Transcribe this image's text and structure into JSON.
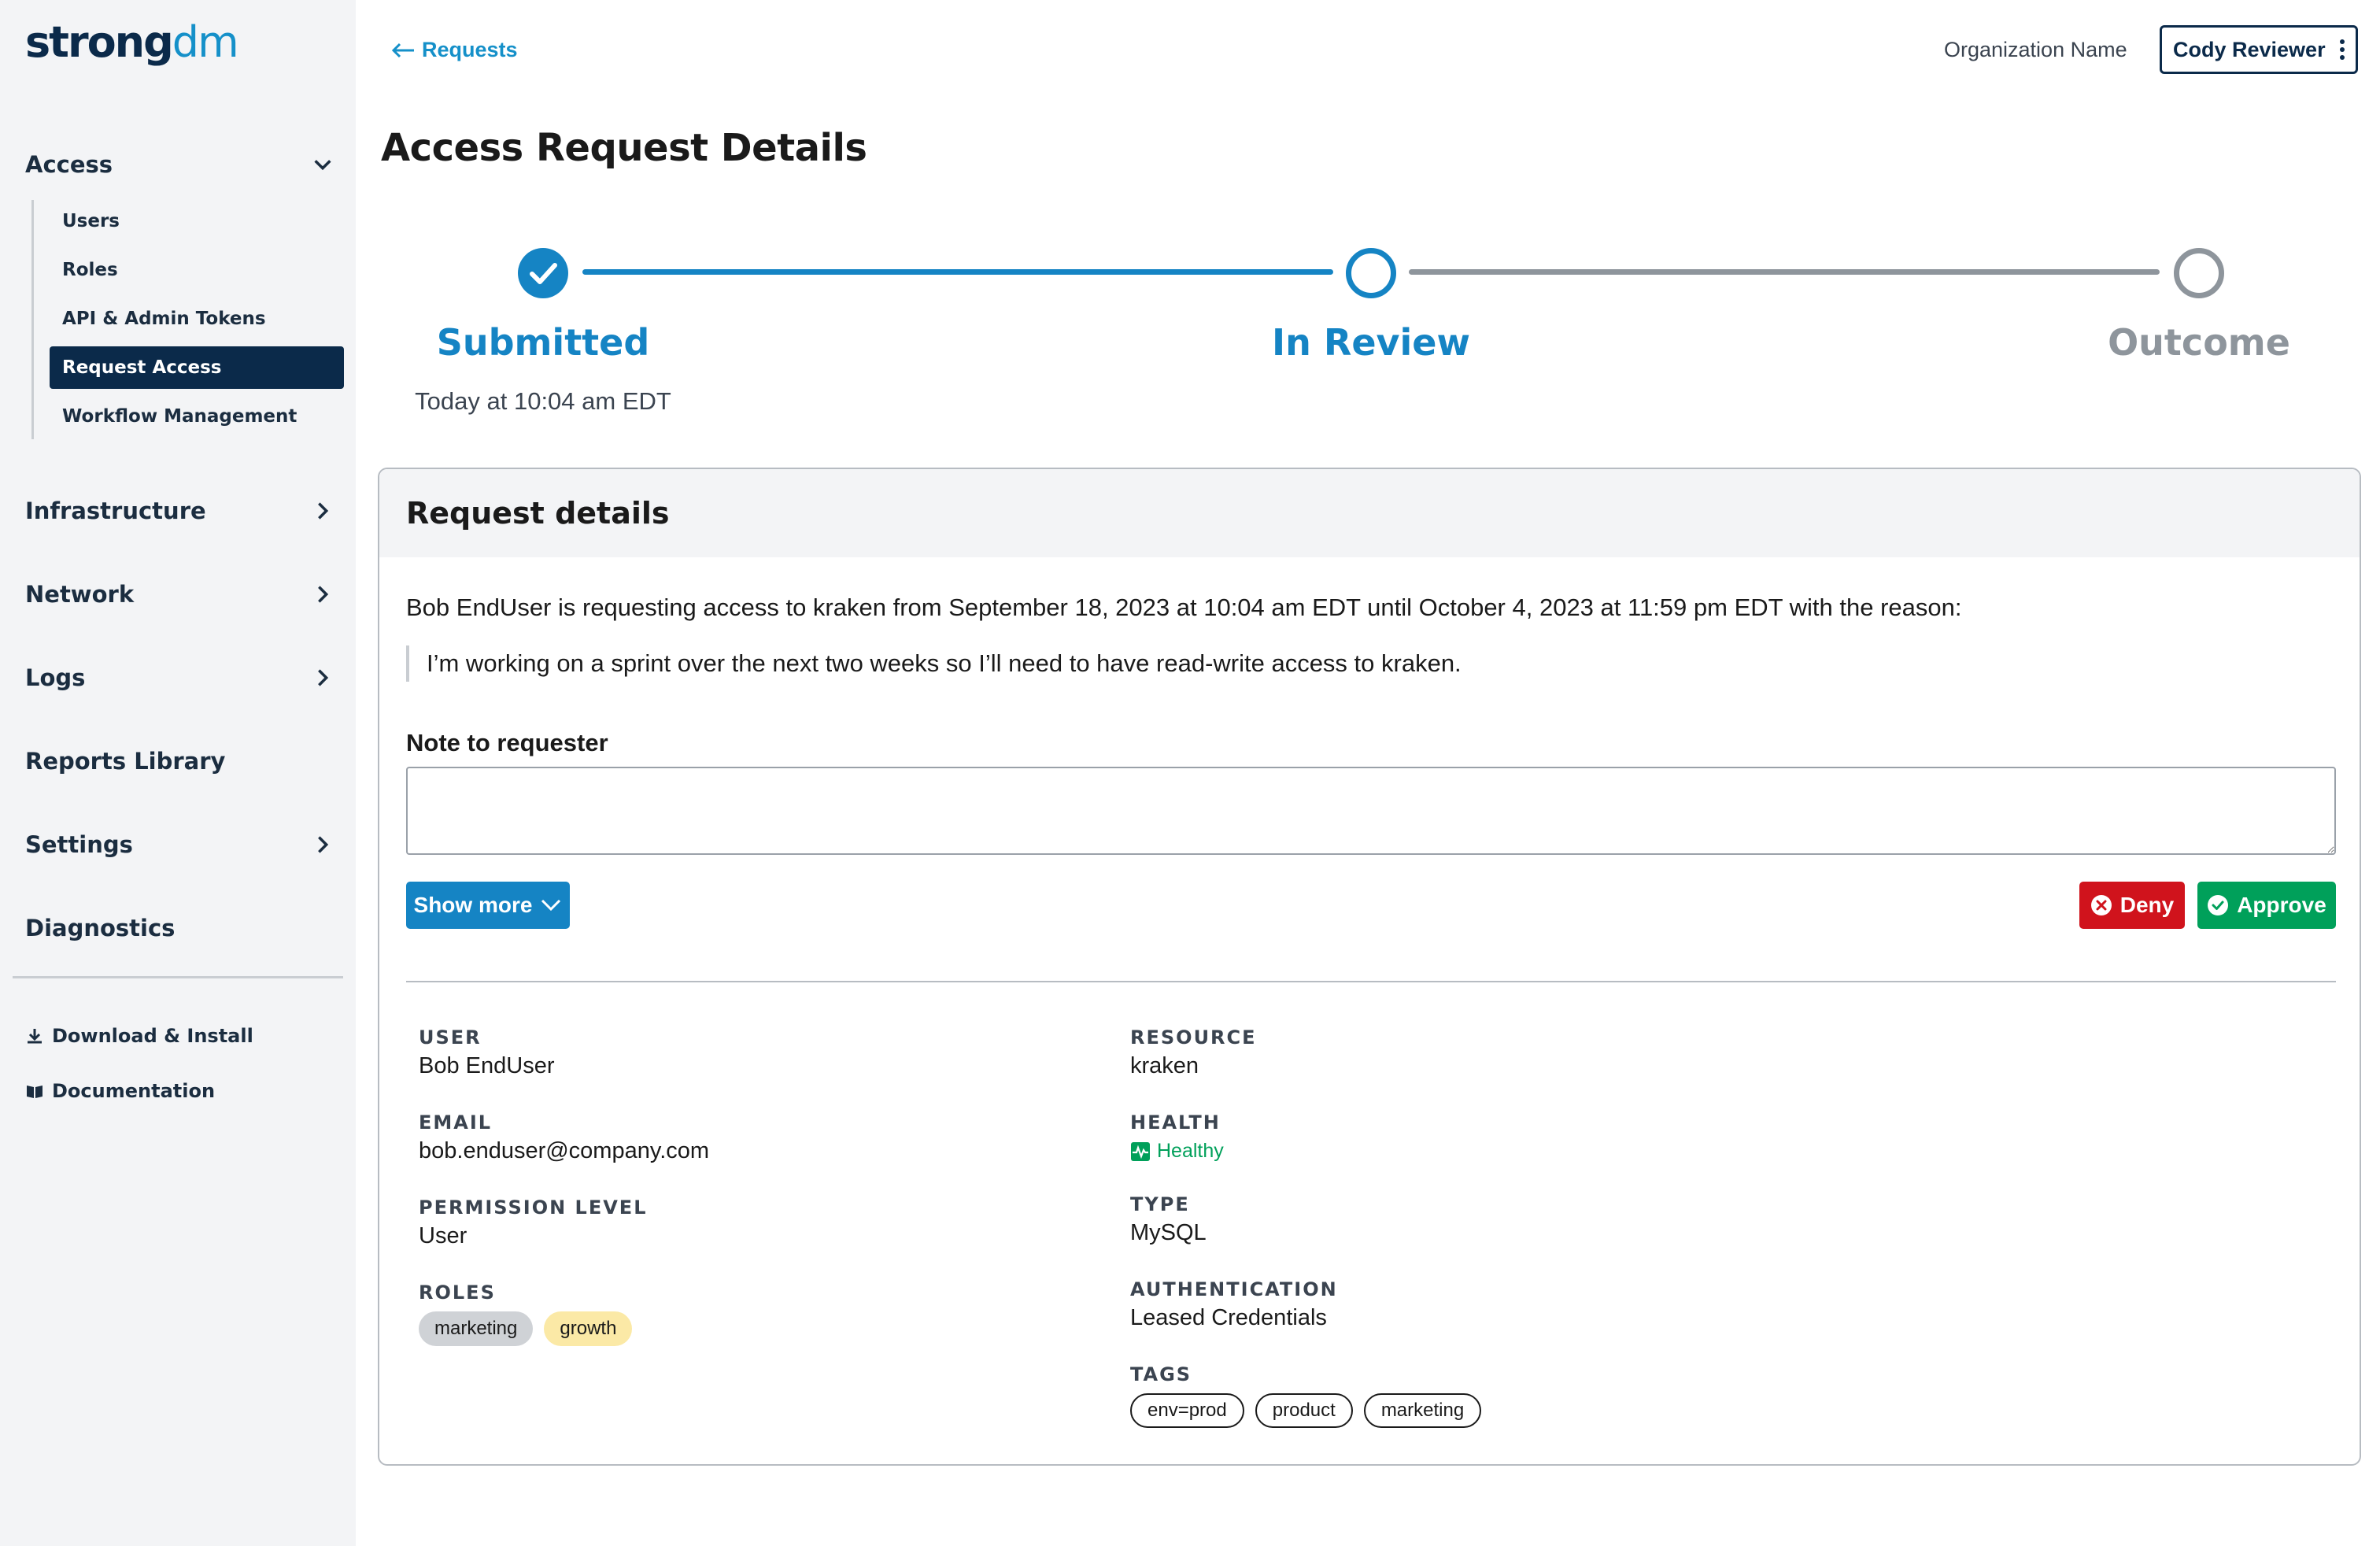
{
  "brand": {
    "strong": "strong",
    "dm": "dm"
  },
  "sidebar": {
    "sections": [
      {
        "label": "Access",
        "icon": "chevron-down-icon"
      },
      {
        "label": "Infrastructure",
        "icon": "chevron-right-icon"
      },
      {
        "label": "Network",
        "icon": "chevron-right-icon"
      },
      {
        "label": "Logs",
        "icon": "chevron-right-icon"
      },
      {
        "label": "Reports Library"
      },
      {
        "label": "Settings",
        "icon": "chevron-right-icon"
      },
      {
        "label": "Diagnostics"
      }
    ],
    "access_items": [
      {
        "label": "Users"
      },
      {
        "label": "Roles"
      },
      {
        "label": "API & Admin Tokens"
      },
      {
        "label": "Request Access",
        "active": true
      },
      {
        "label": "Workflow Management"
      }
    ],
    "links": [
      {
        "label": "Download & Install",
        "icon": "download-icon"
      },
      {
        "label": "Documentation",
        "icon": "book-icon"
      }
    ]
  },
  "header": {
    "back_label": "Requests",
    "org_name": "Organization Name",
    "user_name": "Cody Reviewer"
  },
  "page_title": "Access Request Details",
  "stepper": {
    "steps": [
      {
        "label": "Submitted",
        "status": "complete",
        "subtext": "Today at 10:04 am EDT"
      },
      {
        "label": "In Review",
        "status": "current"
      },
      {
        "label": "Outcome",
        "status": "pending"
      }
    ]
  },
  "card": {
    "title": "Request details",
    "request_text": "Bob EndUser is requesting access to kraken from September 18, 2023 at 10:04 am EDT until October 4, 2023 at 11:59 pm EDT with the reason:",
    "reason": "I’m working on a sprint over the next two weeks so I’ll need to have read-write access to kraken.",
    "note_label": "Note to requester",
    "note_value": "",
    "show_more_label": "Show more",
    "deny_label": "Deny",
    "approve_label": "Approve",
    "left_fields": {
      "user_label": "USER",
      "user_value": "Bob EndUser",
      "email_label": "EMAIL",
      "email_value": "bob.enduser@company.com",
      "permission_label": "PERMISSION LEVEL",
      "permission_value": "User",
      "roles_label": "ROLES",
      "roles": [
        {
          "name": "marketing",
          "color": "gray"
        },
        {
          "name": "growth",
          "color": "yellow"
        }
      ]
    },
    "right_fields": {
      "resource_label": "RESOURCE",
      "resource_value": "kraken",
      "health_label": "HEALTH",
      "health_value": "Healthy",
      "type_label": "TYPE",
      "type_value": "MySQL",
      "auth_label": "AUTHENTICATION",
      "auth_value": "Leased Credentials",
      "tags_label": "TAGS",
      "tags": [
        "env=prod",
        "product",
        "marketing"
      ]
    }
  },
  "colors": {
    "navy": "#0b2a4a",
    "accent_blue": "#1590c9",
    "step_blue": "#1584c4",
    "deny_red": "#d0131c",
    "approve_green": "#00a05a",
    "pending_gray": "#8e959c"
  }
}
